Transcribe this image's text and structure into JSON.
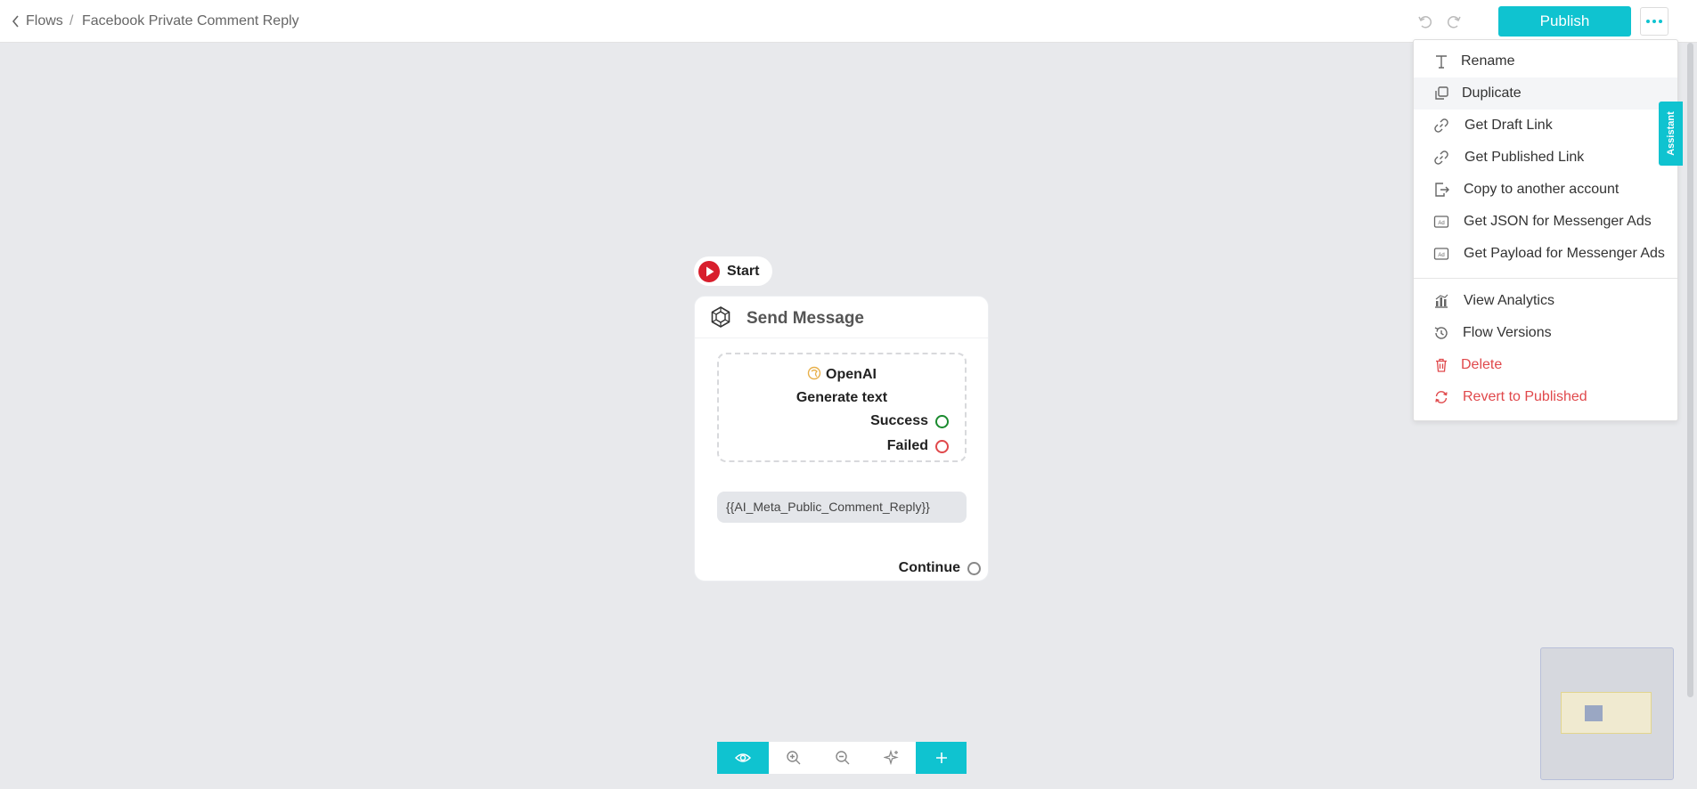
{
  "breadcrumb": {
    "back_label": "Flows",
    "separator": "/",
    "title": "Facebook Private Comment Reply"
  },
  "header": {
    "publish_label": "Publish"
  },
  "menu": {
    "rename": "Rename",
    "duplicate": "Duplicate",
    "get_draft_link": "Get Draft Link",
    "get_published_link": "Get Published Link",
    "copy_to_account": "Copy to another account",
    "get_json_ads": "Get JSON for Messenger Ads",
    "get_payload_ads": "Get Payload for Messenger Ads",
    "view_analytics": "View Analytics",
    "flow_versions": "Flow Versions",
    "delete": "Delete",
    "revert": "Revert to Published"
  },
  "assistant_tab": "Assistant",
  "flow": {
    "start_label": "Start",
    "node_title": "Send Message",
    "ai_provider": "OpenAI",
    "ai_action": "Generate text",
    "success_label": "Success",
    "failed_label": "Failed",
    "variable_text": "{{AI_Meta_Public_Comment_Reply}}",
    "continue_label": "Continue"
  },
  "colors": {
    "accent": "#0fc3d0",
    "danger": "#e0484b",
    "success": "#1a8a2e",
    "start_red": "#d81e2c"
  },
  "icons": {
    "back": "chevron-left-icon",
    "undo": "undo-icon",
    "redo": "redo-icon",
    "more": "ellipsis-icon",
    "rename": "text-icon",
    "duplicate": "copy-icon",
    "draft_link": "link-icon",
    "published_link": "link-icon",
    "copy_account": "export-icon",
    "json_ads": "ad-icon",
    "payload_ads": "ad-icon",
    "analytics": "bar-chart-icon",
    "versions": "history-icon",
    "delete": "trash-icon",
    "revert": "refresh-icon",
    "start": "play-icon",
    "node": "openai-logo-icon",
    "preview": "eye-icon",
    "zoom_in": "zoom-in-icon",
    "zoom_out": "zoom-out-icon",
    "auto_layout": "sparkle-icon",
    "add": "plus-icon"
  }
}
